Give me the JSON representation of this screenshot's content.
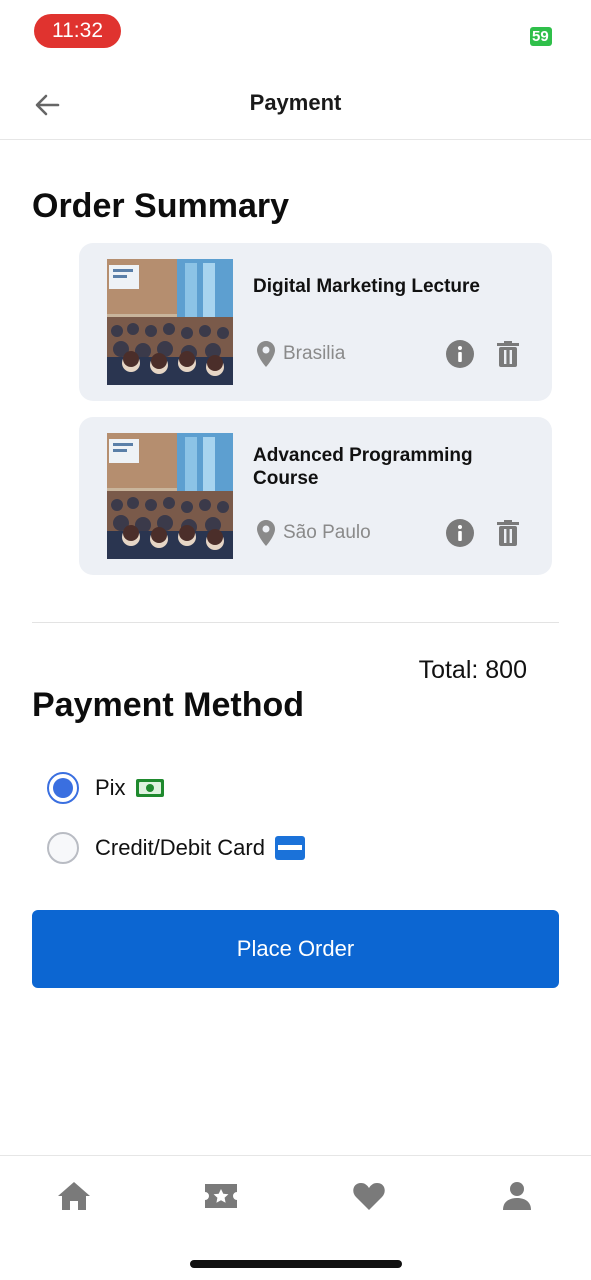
{
  "status_bar": {
    "time": "11:32",
    "battery": "59"
  },
  "header": {
    "title": "Payment"
  },
  "order_summary": {
    "title": "Order Summary",
    "items": [
      {
        "title": "Digital Marketing Lecture",
        "location": "Brasilia"
      },
      {
        "title": "Advanced Programming Course",
        "location": "São Paulo"
      }
    ]
  },
  "total": "Total: 800",
  "payment_method": {
    "title": "Payment Method",
    "options": [
      {
        "label": "Pix",
        "selected": true,
        "icon": "cash-icon"
      },
      {
        "label": "Credit/Debit Card",
        "selected": false,
        "icon": "credit-card-icon"
      }
    ]
  },
  "place_order_label": "Place Order",
  "bottom_nav": [
    "home-icon",
    "ticket-icon",
    "heart-icon",
    "profile-icon"
  ],
  "colors": {
    "accent": "#0c66d2",
    "radio": "#3a6fe0",
    "card_bg": "#edf0f5",
    "icon_gray": "#7a7a7a"
  }
}
